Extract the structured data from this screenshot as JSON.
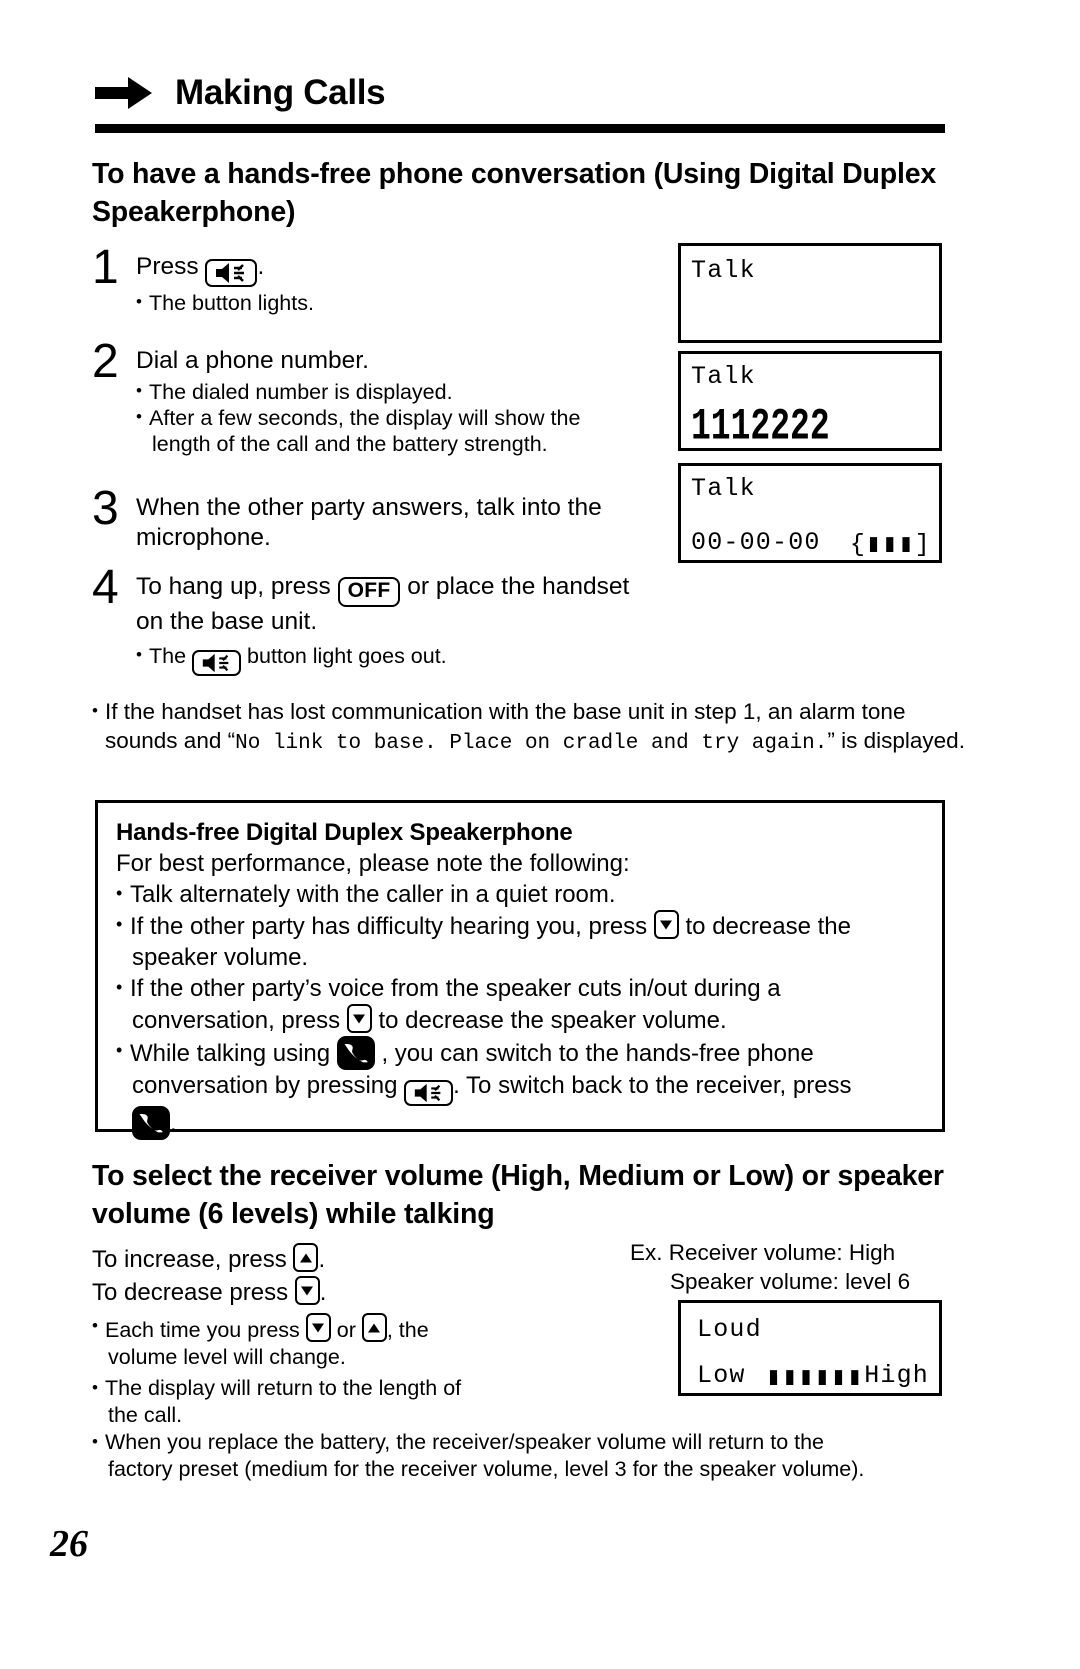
{
  "header": {
    "title": "Making Calls",
    "arrow_icon": "right-arrow-icon"
  },
  "section1": {
    "heading": "To have a hands-free phone conversation (Using Digital Duplex Speakerphone)",
    "steps": [
      {
        "number": "1",
        "main_before": "Press",
        "main_after": ".",
        "key_icon": "speakerphone-icon",
        "bullets": [
          "The button lights."
        ]
      },
      {
        "number": "2",
        "main_before": "Dial a phone number.",
        "main_after": "",
        "bullets": [
          "The dialed number is displayed.",
          "After a few seconds, the display will show the",
          "length of the call and the battery strength."
        ]
      },
      {
        "number": "3",
        "main_before": "When the other party answers, talk into the",
        "main_after": "microphone.",
        "bullets": []
      },
      {
        "number": "4",
        "main_before": "To hang up, press",
        "key_label": "OFF",
        "main_mid": "or place the handset",
        "main_after": "on the base unit.",
        "bullets_before": "The",
        "bullets_after": "button light goes out.",
        "bullet_key_icon": "speakerphone-icon"
      }
    ],
    "displays": [
      {
        "name": "lcd-step1",
        "line1": "Talk",
        "line2": "",
        "line3": ""
      },
      {
        "name": "lcd-step2",
        "line1": "Talk",
        "line2": "1112222",
        "line3": ""
      },
      {
        "name": "lcd-step3",
        "line1": "Talk",
        "line2": "",
        "line3_time": "00-00-00",
        "line3_battery": "{▮▮▮]"
      }
    ]
  },
  "note": {
    "part1": "If the handset has lost communication with the base unit in step 1, an alarm tone sounds and “",
    "mono": "No link to base. Place on cradle and try again.",
    "part2": "” is displayed."
  },
  "tipbox": {
    "title": "Hands-free Digital Duplex Speakerphone",
    "subtitle": "For best performance, please note the following:",
    "bullets": [
      {
        "text": "Talk alternately with the caller in a quiet room."
      },
      {
        "before": "If the other party has difficulty hearing you, press",
        "key": "down-arrow-key",
        "after": "to decrease the",
        "cont": "speaker volume."
      },
      {
        "before": "If the other party’s voice from the speaker cuts in/out during a",
        "cont_before": "conversation, press",
        "key": "down-arrow-key",
        "cont_after": "to decrease the speaker volume."
      },
      {
        "before": "While talking using",
        "key": "talk-handset-icon",
        "after": ", you can switch to the hands-free phone",
        "cont_before": "conversation by pressing",
        "key2": "speakerphone-icon",
        "cont_after": ". To switch back to the receiver, press",
        "cont2_key": "talk-handset-icon",
        "cont2_after": "."
      }
    ]
  },
  "section2": {
    "heading": "To select the receiver volume (High, Medium or Low) or speaker volume (6 levels) while talking",
    "line_increase_before": "To increase, press",
    "line_increase_after": ".",
    "line_increase_key": "up-arrow-key",
    "line_decrease_before": "To decrease press",
    "line_decrease_after": ".",
    "line_decrease_key": "down-arrow-key",
    "bullets": [
      {
        "before": "Each time you press",
        "key": "down-arrow-key",
        "mid": "or",
        "key2": "up-arrow-key",
        "after": ", the",
        "cont": "volume level will change."
      },
      {
        "before": "The display will return to the length of",
        "cont": "the call."
      }
    ],
    "example_label_line1": "Ex. Receiver volume: High",
    "example_label_line2": "Speaker volume: level 6",
    "display": {
      "name": "lcd-volume",
      "line1": "Loud",
      "line2_low": "Low",
      "line2_bars": "▮▮▮▮▮▮",
      "line2_high": "High"
    }
  },
  "bottom_notes": [
    {
      "before": "When you replace the battery, the receiver/speaker volume will return to the",
      "cont": "factory preset (medium for the receiver volume, level 3 for the speaker volume)."
    }
  ],
  "page_number": "26"
}
